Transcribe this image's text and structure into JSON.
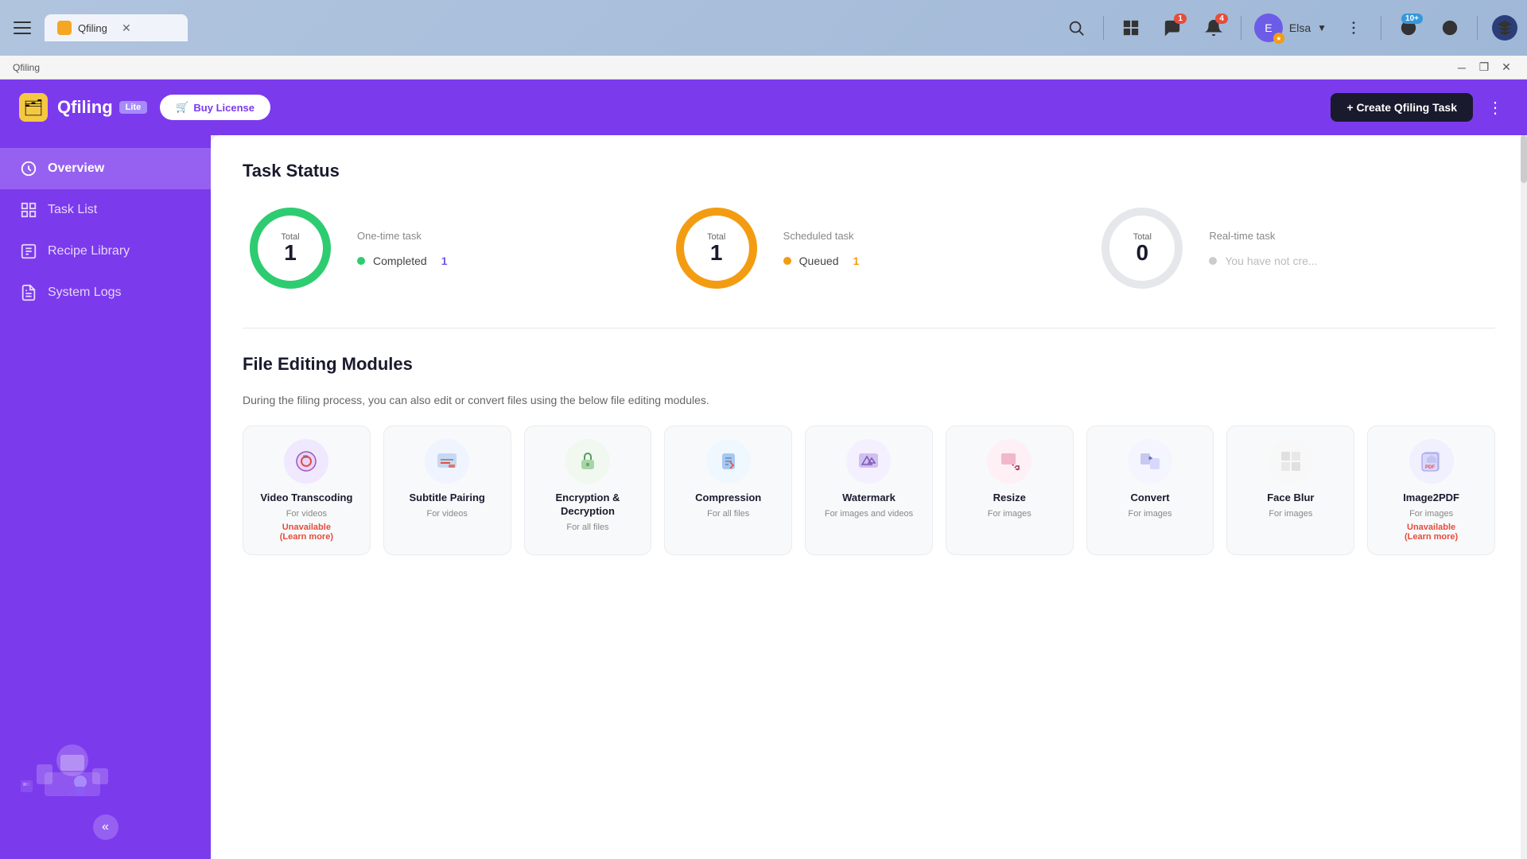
{
  "browser": {
    "tab_title": "Qfiling",
    "tab_icon": "🗂",
    "title_bar_text": "Qfiling",
    "window_minimize": "─",
    "window_restore": "❐",
    "window_close": "✕"
  },
  "header": {
    "app_name": "Qfiling",
    "lite_badge": "Lite",
    "buy_license_label": "Buy License",
    "create_task_label": "+ Create Qfiling Task",
    "more_icon": "⋮"
  },
  "sidebar": {
    "items": [
      {
        "id": "overview",
        "label": "Overview",
        "active": true
      },
      {
        "id": "task-list",
        "label": "Task List",
        "active": false
      },
      {
        "id": "recipe-library",
        "label": "Recipe Library",
        "active": false
      },
      {
        "id": "system-logs",
        "label": "System Logs",
        "active": false
      }
    ],
    "collapse_icon": "«"
  },
  "task_status": {
    "section_title": "Task Status",
    "one_time": {
      "label": "One-time task",
      "total_label": "Total",
      "total": "1",
      "stats": [
        {
          "label": "Completed",
          "value": "1",
          "color": "#2ecc71"
        }
      ]
    },
    "scheduled": {
      "label": "Scheduled task",
      "total_label": "Total",
      "total": "1",
      "stats": [
        {
          "label": "Queued",
          "value": "1",
          "color": "#f39c12"
        }
      ]
    },
    "realtime": {
      "label": "Real-time task",
      "total_label": "Total",
      "total": "0",
      "stats": [
        {
          "label": "You have not cre...",
          "value": "",
          "color": "#ccc"
        }
      ]
    }
  },
  "file_editing": {
    "section_title": "File Editing Modules",
    "description": "During the filing process, you can also edit or convert files using the below file editing modules.",
    "modules": [
      {
        "id": "video-transcoding",
        "name": "Video Transcoding",
        "desc": "For videos",
        "unavailable": true,
        "unavailable_text": "Unavailable (Learn more)"
      },
      {
        "id": "subtitle-pairing",
        "name": "Subtitle Pairing",
        "desc": "For videos",
        "unavailable": false
      },
      {
        "id": "encryption-decryption",
        "name": "Encryption & Decryption",
        "desc": "For all files",
        "unavailable": false
      },
      {
        "id": "compression",
        "name": "Compression",
        "desc": "For all files",
        "unavailable": false
      },
      {
        "id": "watermark",
        "name": "Watermark",
        "desc": "For images and videos",
        "unavailable": false
      },
      {
        "id": "resize",
        "name": "Resize",
        "desc": "For images",
        "unavailable": false
      },
      {
        "id": "convert",
        "name": "Convert",
        "desc": "For images",
        "unavailable": false
      },
      {
        "id": "face-blur",
        "name": "Face Blur",
        "desc": "For images",
        "unavailable": false
      },
      {
        "id": "image2pdf",
        "name": "Image2PDF",
        "desc": "For images",
        "unavailable": true,
        "unavailable_text": "Unavailable (Learn more)"
      }
    ]
  },
  "topbar": {
    "badge_messages": "1",
    "badge_notifications": "4",
    "badge_online": "10+",
    "user_name": "Elsa"
  }
}
